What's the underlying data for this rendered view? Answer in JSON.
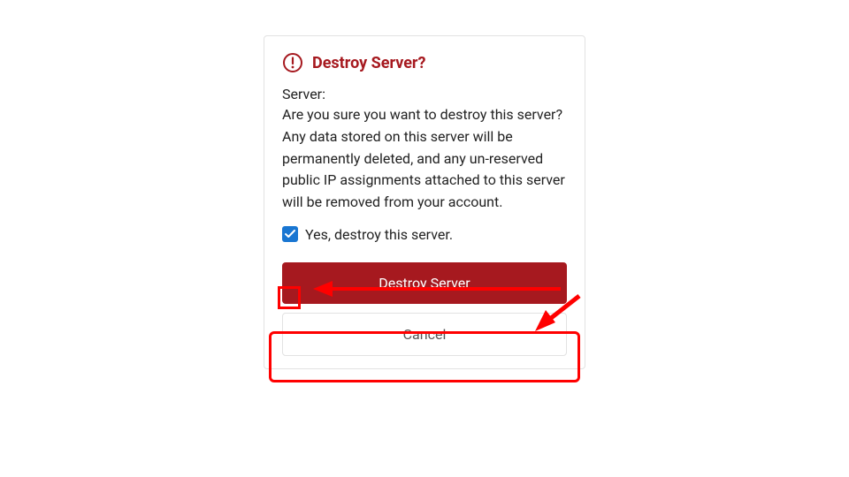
{
  "dialog": {
    "title": "Destroy Server?",
    "server_label": "Server:",
    "body": "Are you sure you want to destroy this server? Any data stored on this server will be permanently deleted, and any un-reserved public IP assignments attached to this server will be removed from your account.",
    "confirm_label": "Yes, destroy this server.",
    "confirm_checked": true,
    "destroy_button": "Destroy Server",
    "cancel_button": "Cancel"
  },
  "colors": {
    "danger": "#a6191f",
    "checkbox": "#1976d2",
    "annotation": "#ff0000"
  }
}
